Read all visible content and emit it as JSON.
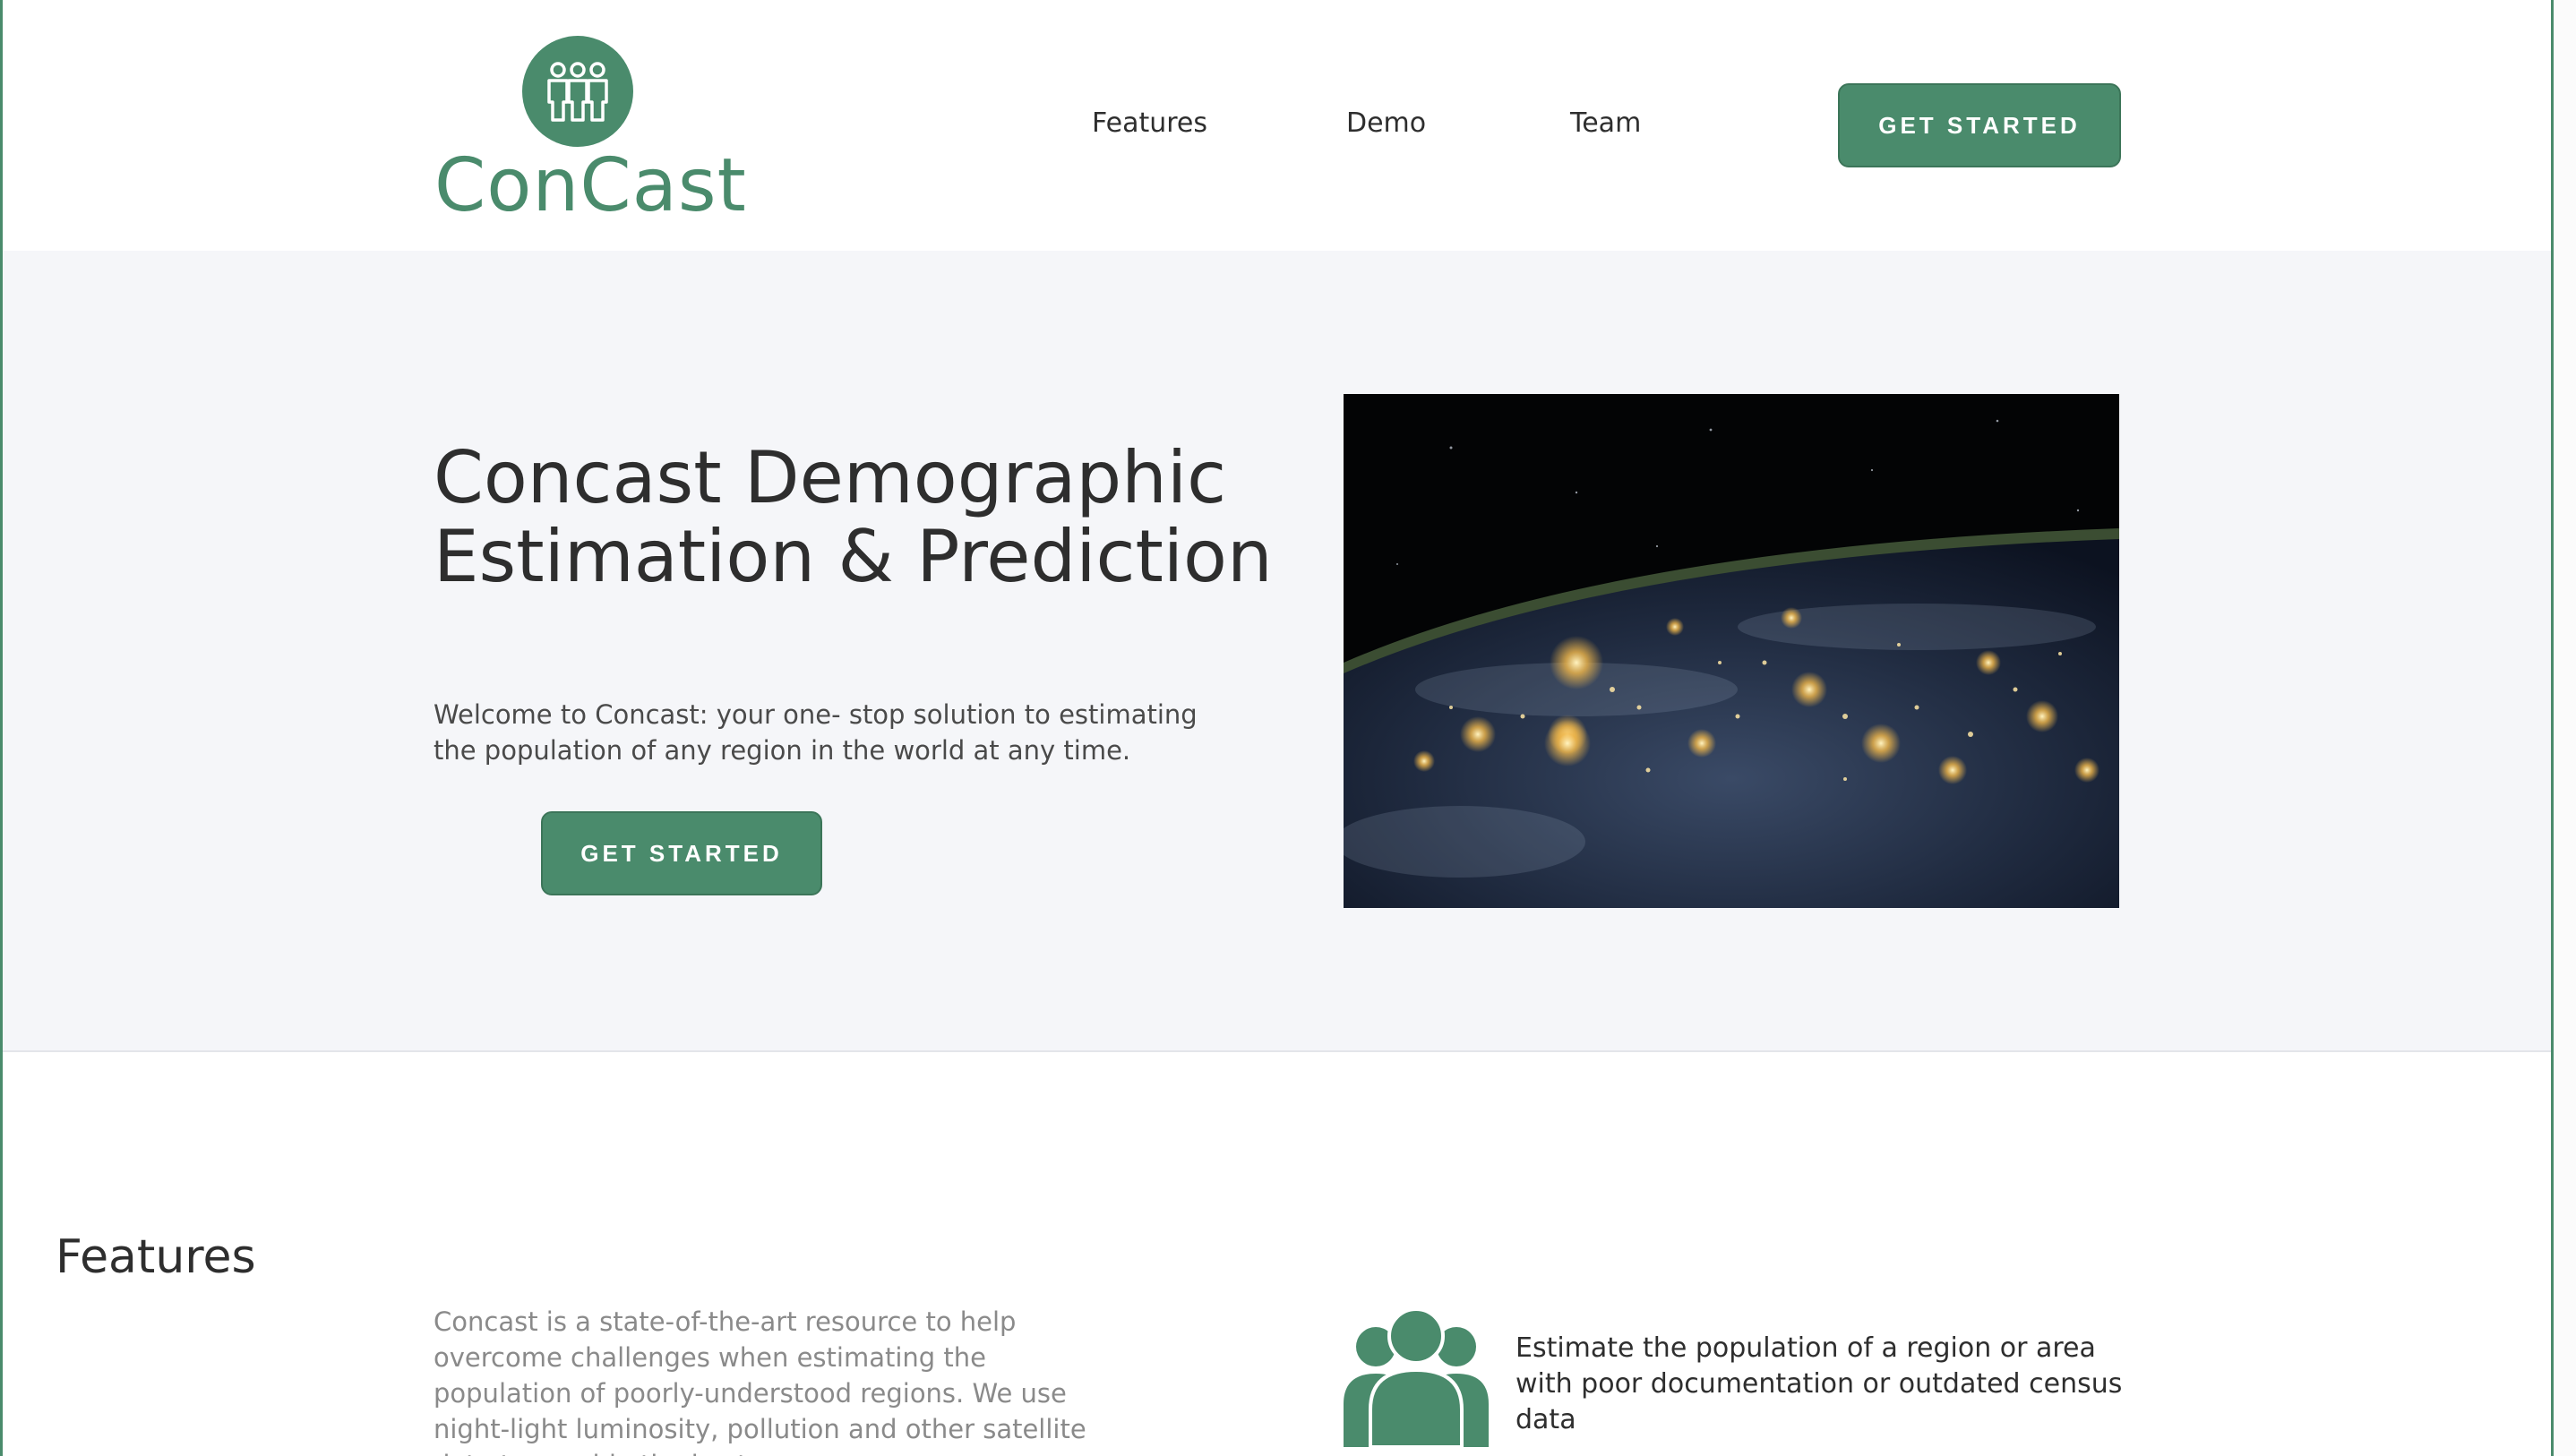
{
  "brand": {
    "name": "ConCast",
    "logo_icon": "people-group-icon",
    "accent_color": "#4a8b6c"
  },
  "nav": {
    "items": [
      {
        "label": "Features"
      },
      {
        "label": "Demo"
      },
      {
        "label": "Team"
      }
    ],
    "cta_label": "GET STARTED"
  },
  "hero": {
    "title": "Concast Demographic Estimation & Prediction",
    "subtitle": "Welcome to Concast: your one- stop solution to estimating the population of any region in the world at any time.",
    "cta_label": "GET STARTED",
    "image": "earth-night-lights-image"
  },
  "features": {
    "heading": "Features",
    "description": "Concast is a state-of-the-art resource to help overcome challenges when estimating the population of poorly-understood regions. We use night-light luminosity, pollution and other satellite data to provide the best",
    "items": [
      {
        "icon": "people-group-icon",
        "text": "Estimate the population of a region or area with poor documentation or outdated census data"
      }
    ]
  }
}
